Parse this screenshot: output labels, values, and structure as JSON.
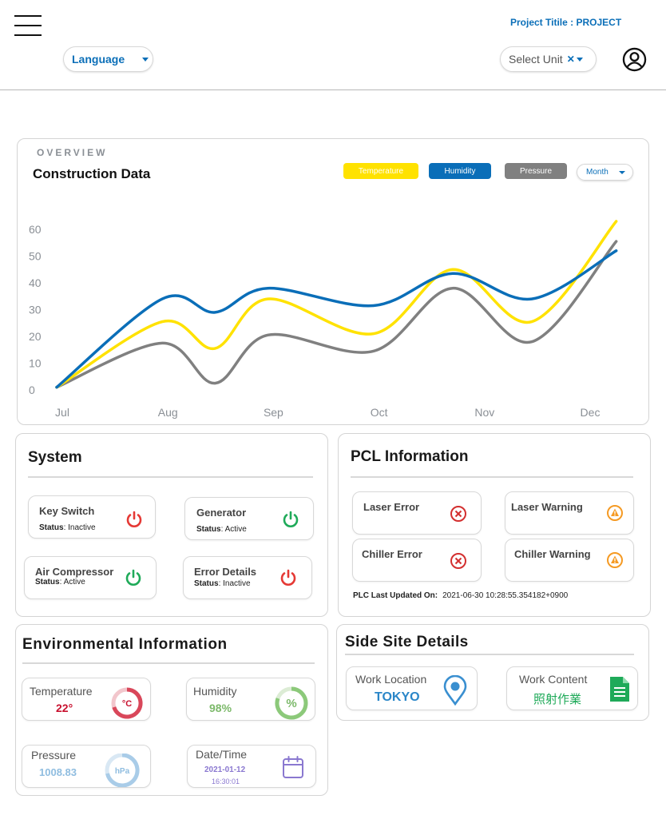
{
  "header": {
    "project_title": "Project Titile : PROJECT",
    "language_label": "Language",
    "unit_label": "Select Unit"
  },
  "overview": {
    "kicker": "OVERVIEW",
    "title": "Construction Data",
    "legend": [
      "Temperature",
      "Humidity",
      "Pressure"
    ],
    "period": "Month"
  },
  "chart_data": {
    "type": "line",
    "title": "Construction Data",
    "x_ticks": [
      "Jul",
      "Aug",
      "Sep",
      "Oct",
      "Nov",
      "Dec"
    ],
    "y_ticks": [
      60,
      50,
      40,
      30,
      20,
      10,
      0
    ],
    "ylim": [
      0,
      60
    ],
    "x_points": [
      0,
      1,
      1.5,
      2,
      3,
      3.75,
      4.5,
      5.3
    ],
    "series": [
      {
        "name": "Temperature",
        "color": "#ffe200",
        "values": [
          1,
          25.5,
          15.5,
          34,
          21,
          45,
          25.5,
          63
        ]
      },
      {
        "name": "Humidity",
        "color": "#0a6eb8",
        "values": [
          1,
          34,
          29,
          38,
          31.5,
          43.5,
          34,
          52
        ]
      },
      {
        "name": "Pressure",
        "color": "#808080",
        "values": [
          1,
          17.5,
          2.5,
          20.5,
          14.5,
          38,
          18,
          55.5
        ]
      }
    ],
    "grid": false,
    "legend_position": "top-right"
  },
  "system": {
    "title": "System",
    "status_prefix": "Status",
    "items": [
      {
        "name": "Key Switch",
        "status": "Inactive",
        "icon": "power-icon",
        "color": "#e53935"
      },
      {
        "name": "Generator",
        "status": "Active",
        "icon": "power-icon",
        "color": "#1faa59"
      },
      {
        "name": "Air Compressor",
        "status": "Active",
        "icon": "power-icon",
        "color": "#1faa59"
      },
      {
        "name": "Error Details",
        "status": "Inactive",
        "icon": "power-icon",
        "color": "#e53935"
      }
    ]
  },
  "pcl": {
    "title": "PCL Information",
    "items": [
      {
        "name": "Laser Error",
        "icon": "error-x-icon",
        "color": "#d32f2f"
      },
      {
        "name": "Laser Warning",
        "icon": "warning-icon",
        "color": "#f59a23"
      },
      {
        "name": "Chiller Error",
        "icon": "error-x-icon",
        "color": "#d32f2f"
      },
      {
        "name": "Chiller Warning",
        "icon": "warning-icon",
        "color": "#f59a23"
      }
    ],
    "updated_label": "PLC Last Updated On:",
    "updated_value": "2021-06-30 10:28:55.354182+0900"
  },
  "environment": {
    "title": "Environmental Information",
    "temperature": {
      "label": "Temperature",
      "value": "22°",
      "unit": "°C",
      "color": "#c8102e"
    },
    "humidity": {
      "label": "Humidity",
      "value": "98%",
      "unit": "%",
      "color": "#7cb96a"
    },
    "pressure": {
      "label": "Pressure",
      "value": "1008.83",
      "unit": "hPa",
      "color": "#8fbde0"
    },
    "datetime": {
      "label": "Date/Time",
      "date": "2021-01-12",
      "time": "16:30:01",
      "color": "#8a78d0"
    }
  },
  "side_site": {
    "title": "Side Site Details",
    "location_label": "Work Location",
    "location_value": "TOKYO",
    "content_label": "Work Content",
    "content_value": "照射作業"
  }
}
